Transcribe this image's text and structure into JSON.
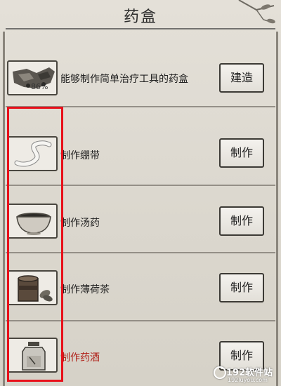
{
  "header": {
    "title": "药盒"
  },
  "upgrade": {
    "description": "能够制作简单治疗工具的药盒",
    "progress": "86%",
    "progress_value": 0.86,
    "button_label": "建造"
  },
  "recipes": [
    {
      "label": "制作绷带",
      "button_label": "制作",
      "icon": "bandage-icon",
      "highlight_color": ""
    },
    {
      "label": "制作汤药",
      "button_label": "制作",
      "icon": "bowl-icon",
      "highlight_color": ""
    },
    {
      "label": "制作薄荷茶",
      "button_label": "制作",
      "icon": "tea-can-icon",
      "highlight_color": ""
    },
    {
      "label": "制作药酒",
      "button_label": "制作",
      "icon": "medicine-jar-icon",
      "highlight_color": "#b02018"
    }
  ],
  "watermark": {
    "main": "192软件站",
    "sub": "192luyou.com"
  },
  "colors": {
    "highlight_box": "#e8101a",
    "background": "#dcd8cf"
  }
}
